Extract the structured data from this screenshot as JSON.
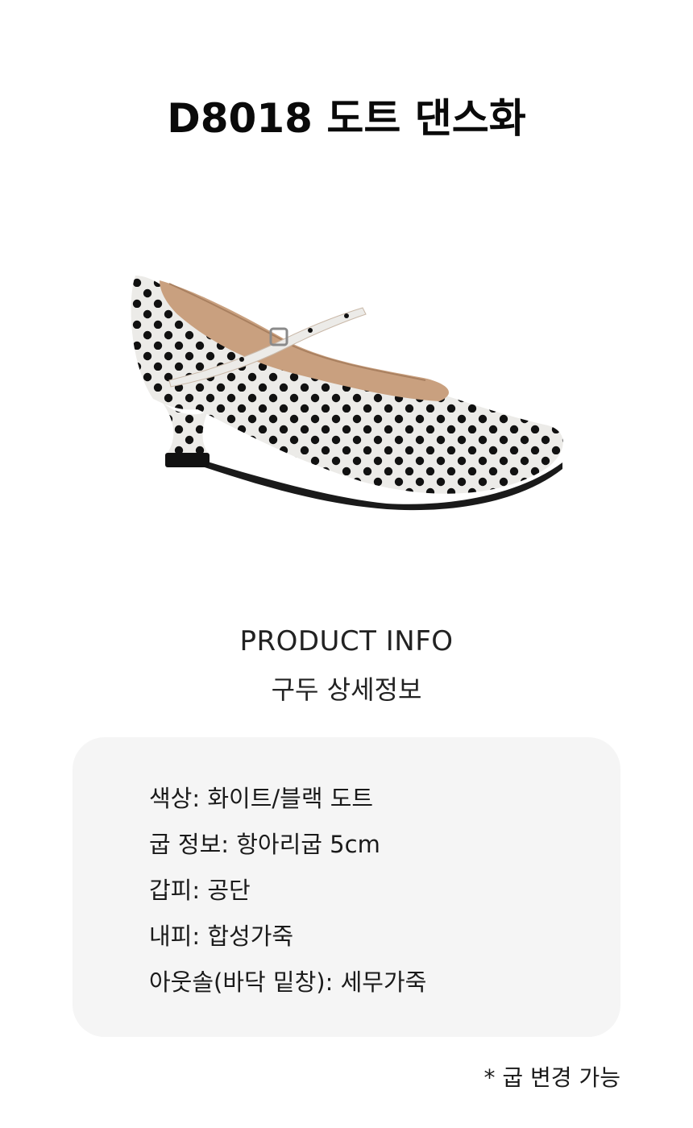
{
  "product": {
    "title": "D8018 도트 댄스화",
    "image_icon": "shoe-icon"
  },
  "info": {
    "heading_en": "PRODUCT INFO",
    "heading_ko": "구두 상세정보"
  },
  "specs": [
    "색상: 화이트/블랙 도트",
    "굽 정보: 항아리굽 5cm",
    "갑피: 공단",
    "내피: 합성가죽",
    "아웃솔(바닥 밑창): 세무가죽"
  ],
  "note": "* 굽 변경 가능",
  "colors": {
    "spec_background": "#f5f5f5",
    "shoe_body": "#ecebe8",
    "dot": "#111111",
    "lining": "#c9a07f"
  }
}
